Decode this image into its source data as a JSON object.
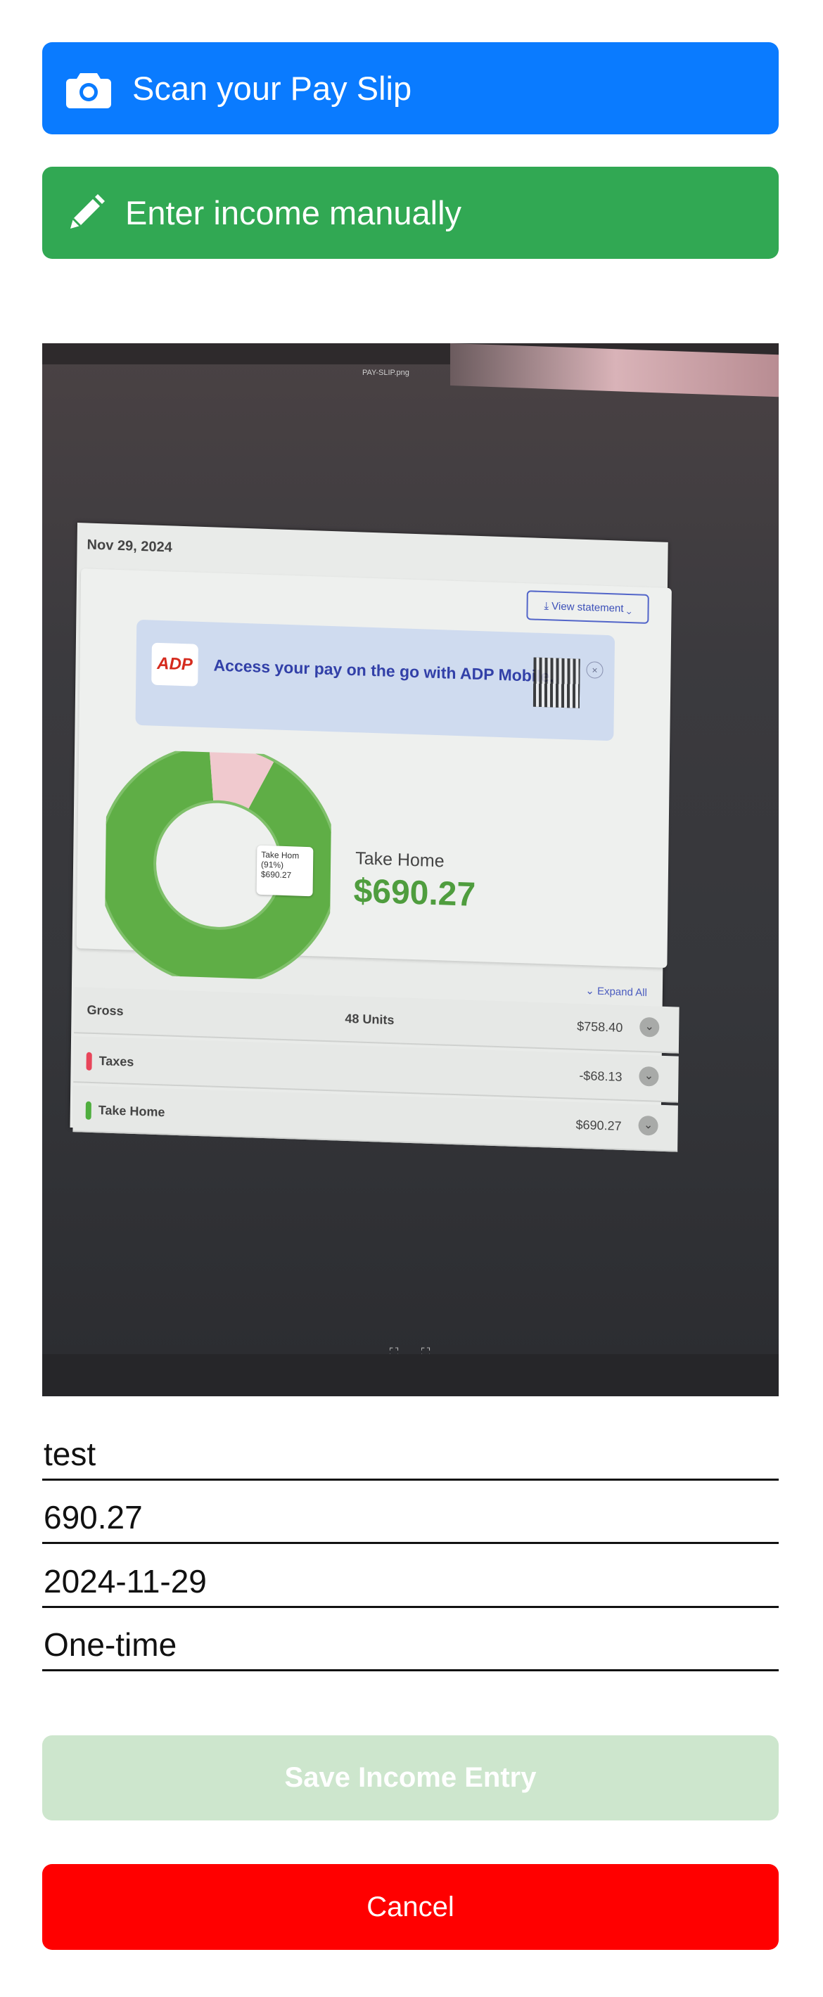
{
  "actions": {
    "scan_label": "Scan your Pay Slip",
    "manual_label": "Enter income manually",
    "scan_icon": "camera-icon",
    "manual_icon": "pencil-icon",
    "scan_color": "#0a7bff",
    "manual_color": "#31a853"
  },
  "photo": {
    "filename": "PAY-SLIP.png",
    "slip": {
      "date": "Nov 29, 2024",
      "view_statement": "⤓ View statement ⌄",
      "banner_logo": "ADP",
      "banner_text": "Access your pay on the go with ADP Mobile.",
      "tooltip_line1": "Take Hom",
      "tooltip_line2": "(91%)",
      "tooltip_line3": "$690.27",
      "take_home_label": "Take Home",
      "take_home_value": "$690.27",
      "expand_all": "⌄ Expand All",
      "rows": [
        {
          "label": "Gross",
          "units": "48 Units",
          "amount": "$758.40"
        },
        {
          "label": "Taxes",
          "units": "",
          "amount": "-$68.13"
        },
        {
          "label": "Take Home",
          "units": "",
          "amount": "$690.27"
        }
      ],
      "donut": {
        "take_home_fraction": 0.91,
        "taxes_fraction": 0.09,
        "take_home_color": "#5fae46",
        "taxes_color": "#f0c9ce"
      }
    }
  },
  "form": {
    "name_value": "test",
    "amount_value": "690.27",
    "date_value": "2024-11-29",
    "frequency_value": "One-time"
  },
  "buttons": {
    "save_label": "Save Income Entry",
    "cancel_label": "Cancel",
    "save_color": "#cde6cd",
    "cancel_color": "#ff0000"
  }
}
